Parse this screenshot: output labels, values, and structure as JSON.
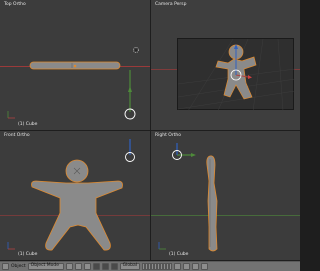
{
  "viewports": {
    "top": {
      "label": "Top Ortho",
      "object": "(1) Cube"
    },
    "camera": {
      "label": "Camera Persp"
    },
    "front": {
      "label": "Front Ortho",
      "object": "(1) Cube"
    },
    "right": {
      "label": "Right Ortho",
      "object": "(1) Cube"
    }
  },
  "status_bar": {
    "view_menu": "Object",
    "mode": "Object Mode",
    "pivot": "Global"
  },
  "colors": {
    "viewport_bg": "#3c3c3c",
    "mesh": "#8a8a8a",
    "selection_outline": "#e08a2e",
    "x_axis": "#9b3a3a",
    "y_axis": "#4e8a3a"
  }
}
